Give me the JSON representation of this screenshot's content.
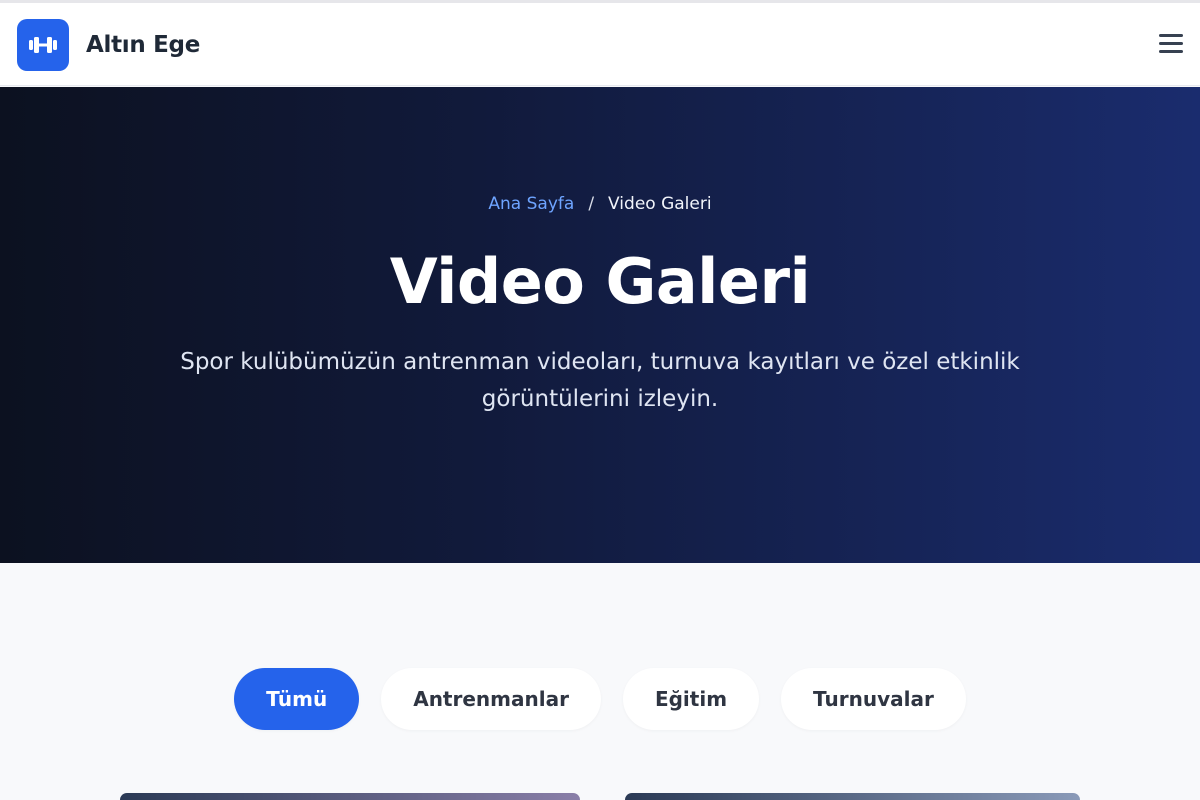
{
  "header": {
    "brand": "Altın Ege",
    "logo_icon": "dumbbell-icon",
    "menu_icon": "hamburger-menu-icon"
  },
  "hero": {
    "breadcrumb": {
      "home": "Ana Sayfa",
      "separator": "/",
      "current": "Video Galeri"
    },
    "title": "Video Galeri",
    "subtitle": "Spor kulübümüzün antrenman videoları, turnuva kayıtları ve özel etkinlik görüntülerini izleyin."
  },
  "filters": {
    "items": [
      {
        "label": "Tümü",
        "active": true
      },
      {
        "label": "Antrenmanlar",
        "active": false
      },
      {
        "label": "Eğitim",
        "active": false
      },
      {
        "label": "Turnuvalar",
        "active": false
      }
    ]
  },
  "colors": {
    "accent": "#2563eb",
    "hero_start": "#0c1120",
    "hero_end": "#1a2c6e",
    "breadcrumb_link": "#6ea4ff"
  }
}
